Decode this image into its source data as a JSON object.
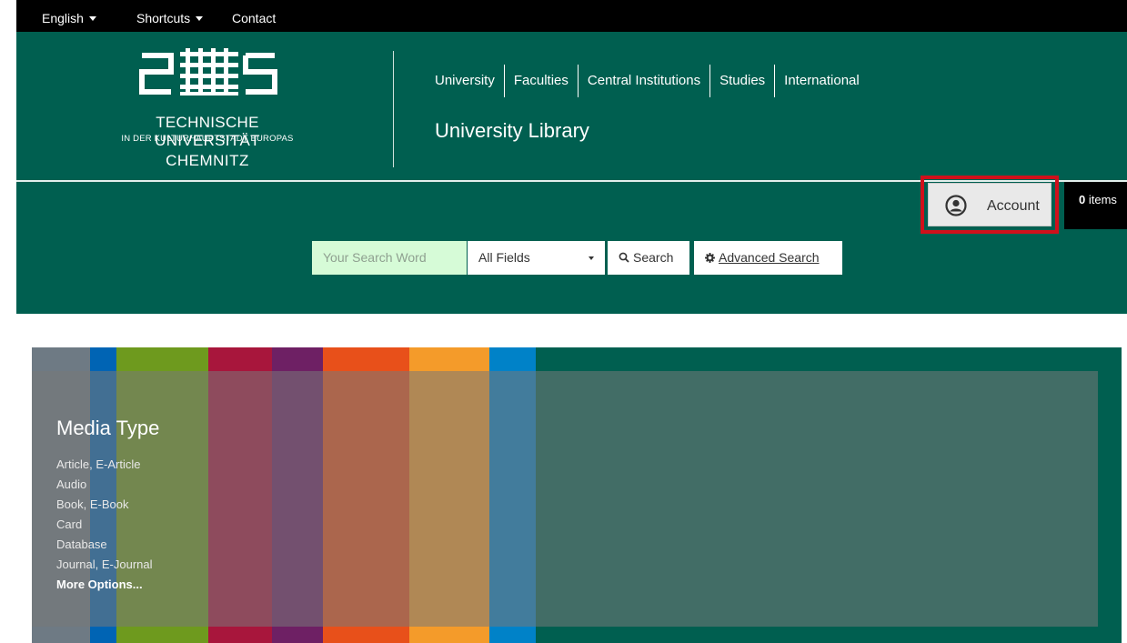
{
  "topbar": {
    "language": "English",
    "shortcuts": "Shortcuts",
    "contact": "Contact"
  },
  "logo": {
    "line1": "TECHNISCHE UNIVERSITÄT",
    "line2": "IN DER KULTURHAUPTSTADT EUROPAS",
    "line3": "CHEMNITZ"
  },
  "nav": {
    "items": [
      "University",
      "Faculties",
      "Central Institutions",
      "Studies",
      "International"
    ]
  },
  "page_title": "University Library",
  "account": {
    "label": "Account",
    "icon": "user-circle-icon"
  },
  "cart": {
    "count": "0",
    "label": " items"
  },
  "search": {
    "placeholder": "Your Search Word",
    "field_selected": "All Fields",
    "search_label": "Search",
    "advanced_label": "Advanced Search"
  },
  "media_type": {
    "title": "Media Type",
    "options": [
      "Article, E-Article",
      "Audio",
      "Book, E-Book",
      "Card",
      "Database",
      "Journal, E-Journal"
    ],
    "more": "More Options..."
  },
  "colors": {
    "brand_green": "#005f50",
    "highlight_red": "#d0101b",
    "search_input_bg": "#d6fbd7",
    "stripes": [
      "#6e7a84",
      "#0064b4",
      "#6e9a1e",
      "#a8163c",
      "#6e2064",
      "#e8501a",
      "#f49b2a",
      "#0082c8"
    ]
  }
}
